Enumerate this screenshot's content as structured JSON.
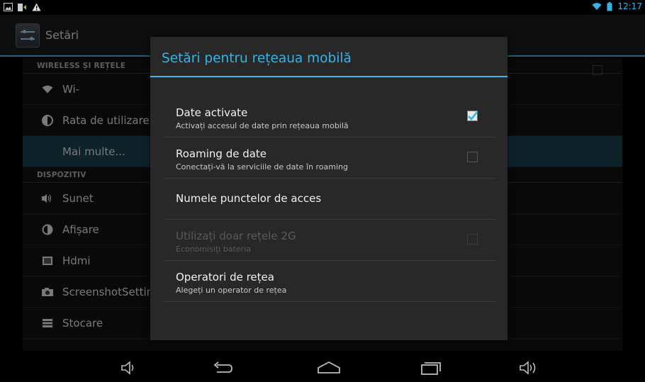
{
  "status_bar": {
    "left_icons": [
      "gallery-icon",
      "usb-debug-icon",
      "warning-icon"
    ],
    "time": "12:17",
    "accent": "#33b5e5"
  },
  "action_bar": {
    "title": "Setări"
  },
  "settings": {
    "sections": [
      {
        "header": "WIRELESS ȘI REȚELE",
        "items": [
          {
            "label": "Wi-",
            "icon": "wifi-icon"
          },
          {
            "label": "Rata de utilizare a",
            "icon": "data-usage-icon"
          },
          {
            "label": "Mai multe...",
            "icon": "",
            "selected": true
          }
        ]
      },
      {
        "header": "DISPOZITIV",
        "items": [
          {
            "label": "Sunet",
            "icon": "sound-icon"
          },
          {
            "label": "Afișare",
            "icon": "display-icon"
          },
          {
            "label": "Hdmi",
            "icon": "hdmi-icon"
          },
          {
            "label": "ScreenshotSetting",
            "icon": "camera-icon"
          },
          {
            "label": "Stocare",
            "icon": "storage-icon"
          }
        ]
      }
    ]
  },
  "dialog": {
    "title": "Setări pentru rețeaua mobilă",
    "items": [
      {
        "title": "Date activate",
        "summary": "Activați accesul de date prin rețeaua mobilă",
        "checkbox": true,
        "checked": true,
        "enabled": true
      },
      {
        "title": "Roaming de date",
        "summary": "Conectați-vă la serviciile de date în roaming",
        "checkbox": true,
        "checked": false,
        "enabled": true
      },
      {
        "title": "Numele punctelor de acces",
        "summary": "",
        "checkbox": false,
        "enabled": true
      },
      {
        "title": "Utilizați doar rețele 2G",
        "summary": "Economisiți bateria",
        "checkbox": true,
        "checked": false,
        "enabled": false
      },
      {
        "title": "Operatori de rețea",
        "summary": "Alegeți un operator de rețea",
        "checkbox": false,
        "enabled": true
      }
    ]
  },
  "nav_bar": {
    "buttons": [
      "volume-down-icon",
      "back-icon",
      "home-icon",
      "recent-apps-icon",
      "volume-up-icon"
    ]
  }
}
